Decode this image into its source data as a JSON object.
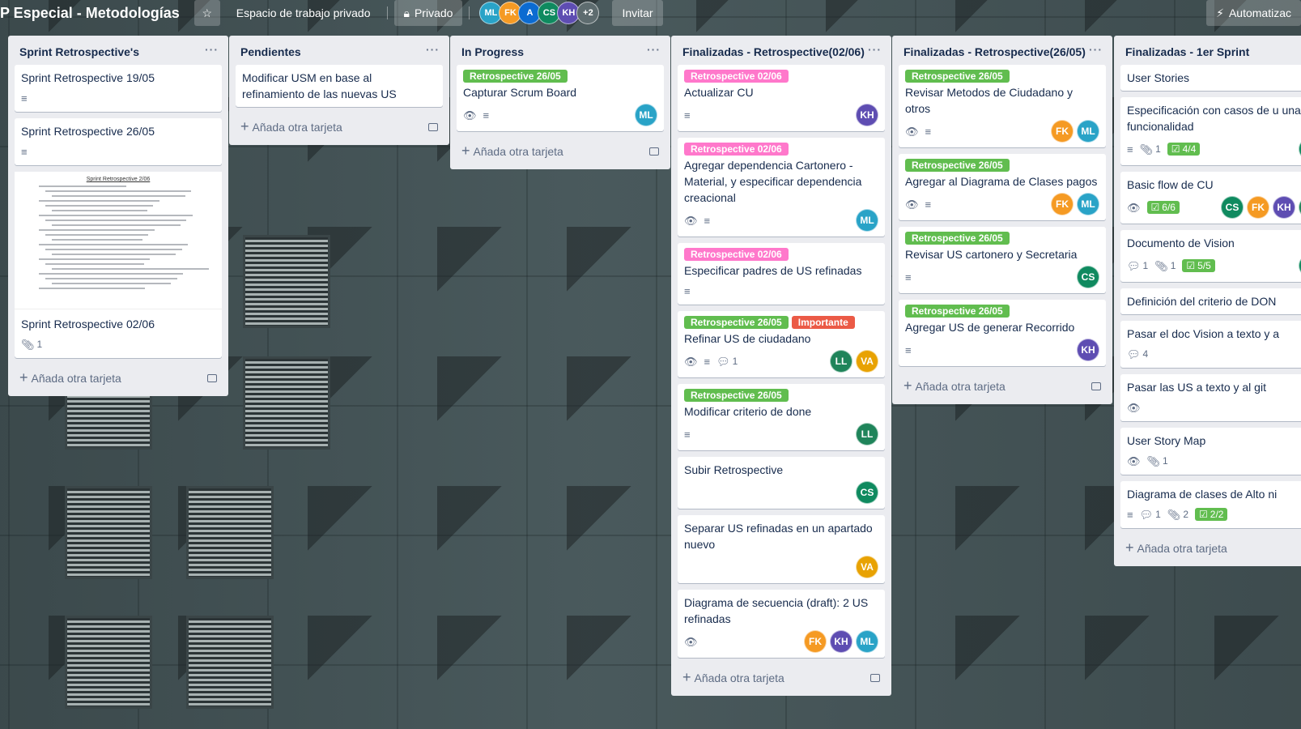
{
  "header": {
    "board_title": "P Especial - Metodologías",
    "workspace": "Espacio de trabajo privado",
    "visibility": "Privado",
    "members": [
      {
        "initials": "ML",
        "color": "#29a3c7"
      },
      {
        "initials": "FK",
        "color": "#f59a23"
      },
      {
        "initials": "A",
        "color": "#0b6bd1"
      },
      {
        "initials": "CS",
        "color": "#0f8a5f"
      },
      {
        "initials": "KH",
        "color": "#5e4db2"
      }
    ],
    "more_members": "+2",
    "invite": "Invitar",
    "automation": "Automatizac"
  },
  "add_card_label": "Añada otra tarjeta",
  "colors": {
    "green": "#61bd4f",
    "pink": "#ff78cb",
    "red": "#eb5a46"
  },
  "lists": [
    {
      "title": "Sprint Retrospective's",
      "cards": [
        {
          "title": "Sprint Retrospective 19/05",
          "desc": true
        },
        {
          "title": "Sprint Retrospective 26/05",
          "desc": true
        },
        {
          "title": "Sprint Retrospective 02/06",
          "attachments": "1",
          "cover": "Sprint Retrospective 2/06"
        }
      ]
    },
    {
      "title": "Pendientes",
      "cards": [
        {
          "title": "Modificar USM en base al refinamiento de las nuevas US"
        }
      ]
    },
    {
      "title": "In Progress",
      "cards": [
        {
          "labels": [
            "Retrospective 26/05"
          ],
          "title": "Capturar Scrum Board",
          "watch": true,
          "desc": true,
          "members": [
            "ML"
          ]
        }
      ]
    },
    {
      "title": "Finalizadas - Retrospective(02/06)",
      "cards": [
        {
          "labels": [
            "Retrospective 02/06"
          ],
          "title": "Actualizar CU",
          "desc": true,
          "members": [
            "KH"
          ]
        },
        {
          "labels": [
            "Retrospective 02/06"
          ],
          "title": "Agregar dependencia Cartonero - Material, y especificar dependencia creacional",
          "watch": true,
          "desc": true,
          "members": [
            "ML"
          ]
        },
        {
          "labels": [
            "Retrospective 02/06"
          ],
          "title": "Especificar padres de US refinadas",
          "desc": true
        },
        {
          "labels": [
            "Retrospective 26/05",
            "Importante"
          ],
          "title": "Refinar US de ciudadano",
          "watch": true,
          "desc": true,
          "comments": "1",
          "members": [
            "LL",
            "VA"
          ]
        },
        {
          "labels": [
            "Retrospective 26/05"
          ],
          "title": "Modificar criterio de done",
          "desc": true,
          "members": [
            "LL"
          ]
        },
        {
          "title": "Subir Retrospective",
          "members": [
            "CS"
          ]
        },
        {
          "title": "Separar US refinadas en un apartado nuevo",
          "members": [
            "VA"
          ]
        },
        {
          "title": "Diagrama de secuencia (draft): 2 US refinadas",
          "watch": true,
          "members": [
            "FK",
            "KH",
            "ML"
          ]
        }
      ]
    },
    {
      "title": "Finalizadas - Retrospective(26/05)",
      "cards": [
        {
          "labels": [
            "Retrospective 26/05"
          ],
          "title": "Revisar Metodos de Ciudadano y otros",
          "watch": true,
          "desc": true,
          "members": [
            "FK",
            "ML"
          ]
        },
        {
          "labels": [
            "Retrospective 26/05"
          ],
          "title": "Agregar al Diagrama de Clases pagos",
          "watch": true,
          "desc": true,
          "members": [
            "FK",
            "ML"
          ]
        },
        {
          "labels": [
            "Retrospective 26/05"
          ],
          "title": "Revisar US cartonero y Secretaria",
          "desc": true,
          "members": [
            "CS"
          ]
        },
        {
          "labels": [
            "Retrospective 26/05"
          ],
          "title": "Agregar US de generar Recorrido",
          "desc": true,
          "members": [
            "KH"
          ]
        }
      ]
    },
    {
      "title": "Finalizadas - 1er Sprint",
      "cards": [
        {
          "title": "User Stories"
        },
        {
          "title": "Especificación con casos de u una funcionalidad",
          "desc": true,
          "attachments": "1",
          "checklist": "4/4",
          "members": [
            "CS"
          ]
        },
        {
          "title": "Basic flow de CU",
          "watch": true,
          "checklist": "6/6",
          "members": [
            "CS",
            "FK",
            "KH",
            "LL"
          ]
        },
        {
          "title": "Documento de Vision",
          "comments": "1",
          "attachments": "1",
          "checklist": "5/5",
          "members": [
            "CS"
          ]
        },
        {
          "title": "Definición del criterio de DON"
        },
        {
          "title": "Pasar el doc Vision a texto y a",
          "comments": "4"
        },
        {
          "title": "Pasar las US a texto y al git",
          "watch": true
        },
        {
          "title": "User Story Map",
          "watch": true,
          "attachments": "1"
        },
        {
          "title": "Diagrama de clases de Alto ni",
          "desc": true,
          "comments": "1",
          "attachments": "2",
          "checklist": "2/2"
        }
      ]
    }
  ],
  "member_colors": {
    "ML": "#29a3c7",
    "FK": "#f59a23",
    "KH": "#5e4db2",
    "CS": "#0f8a5f",
    "LL": "#1f845a",
    "VA": "#e8a202",
    "A": "#0b6bd1"
  }
}
